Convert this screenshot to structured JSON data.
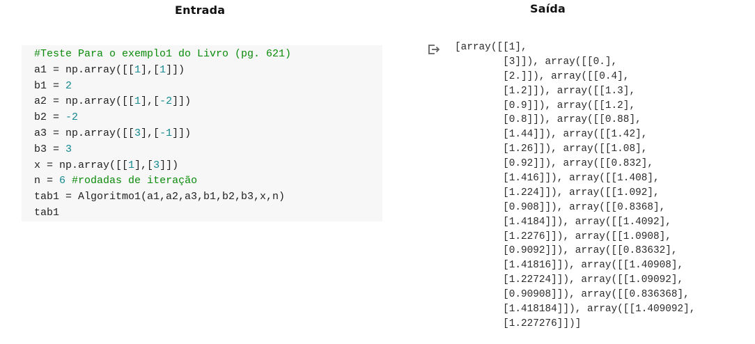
{
  "headings": {
    "input": "Entrada",
    "output": "Saída"
  },
  "icons": {
    "output": "output-redirect-icon"
  },
  "colors": {
    "cell_background": "#f7f7f7",
    "comment": "#0a8a0a",
    "number": "#13888f",
    "text": "#212121"
  },
  "code_lines": [
    [
      {
        "t": "#Teste Para o exemplo1 do Livro (pg. 621)",
        "k": "comment"
      }
    ],
    [
      {
        "t": "a1 = np.array([[",
        "k": "plain"
      },
      {
        "t": "1",
        "k": "num"
      },
      {
        "t": "],[",
        "k": "plain"
      },
      {
        "t": "1",
        "k": "num"
      },
      {
        "t": "]])",
        "k": "plain"
      }
    ],
    [
      {
        "t": "b1 = ",
        "k": "plain"
      },
      {
        "t": "2",
        "k": "num"
      }
    ],
    [
      {
        "t": "a2 = np.array([[",
        "k": "plain"
      },
      {
        "t": "1",
        "k": "num"
      },
      {
        "t": "],[",
        "k": "plain"
      },
      {
        "t": "-2",
        "k": "num"
      },
      {
        "t": "]])",
        "k": "plain"
      }
    ],
    [
      {
        "t": "b2 = ",
        "k": "plain"
      },
      {
        "t": "-2",
        "k": "num"
      }
    ],
    [
      {
        "t": "a3 = np.array([[",
        "k": "plain"
      },
      {
        "t": "3",
        "k": "num"
      },
      {
        "t": "],[",
        "k": "plain"
      },
      {
        "t": "-1",
        "k": "num"
      },
      {
        "t": "]])",
        "k": "plain"
      }
    ],
    [
      {
        "t": "b3 = ",
        "k": "plain"
      },
      {
        "t": "3",
        "k": "num"
      }
    ],
    [
      {
        "t": "x = np.array([[",
        "k": "plain"
      },
      {
        "t": "1",
        "k": "num"
      },
      {
        "t": "],[",
        "k": "plain"
      },
      {
        "t": "3",
        "k": "num"
      },
      {
        "t": "]])",
        "k": "plain"
      }
    ],
    [
      {
        "t": "n = ",
        "k": "plain"
      },
      {
        "t": "6",
        "k": "num"
      },
      {
        "t": " ",
        "k": "plain"
      },
      {
        "t": "#rodadas de iteração",
        "k": "comment"
      }
    ],
    [
      {
        "t": "tab1 = Algoritmo1(a1,a2,a3,b1,b2,b3,x,n)",
        "k": "plain"
      }
    ],
    [
      {
        "t": "tab1",
        "k": "plain"
      }
    ]
  ],
  "output_lines": [
    "[array([[1],",
    "        [3]]), array([[0.],",
    "        [2.]]), array([[0.4],",
    "        [1.2]]), array([[1.3],",
    "        [0.9]]), array([[1.2],",
    "        [0.8]]), array([[0.88],",
    "        [1.44]]), array([[1.42],",
    "        [1.26]]), array([[1.08],",
    "        [0.92]]), array([[0.832],",
    "        [1.416]]), array([[1.408],",
    "        [1.224]]), array([[1.092],",
    "        [0.908]]), array([[0.8368],",
    "        [1.4184]]), array([[1.4092],",
    "        [1.2276]]), array([[1.0908],",
    "        [0.9092]]), array([[0.83632],",
    "        [1.41816]]), array([[1.40908],",
    "        [1.22724]]), array([[1.09092],",
    "        [0.90908]]), array([[0.836368],",
    "        [1.418184]]), array([[1.409092],",
    "        [1.227276]])]"
  ]
}
